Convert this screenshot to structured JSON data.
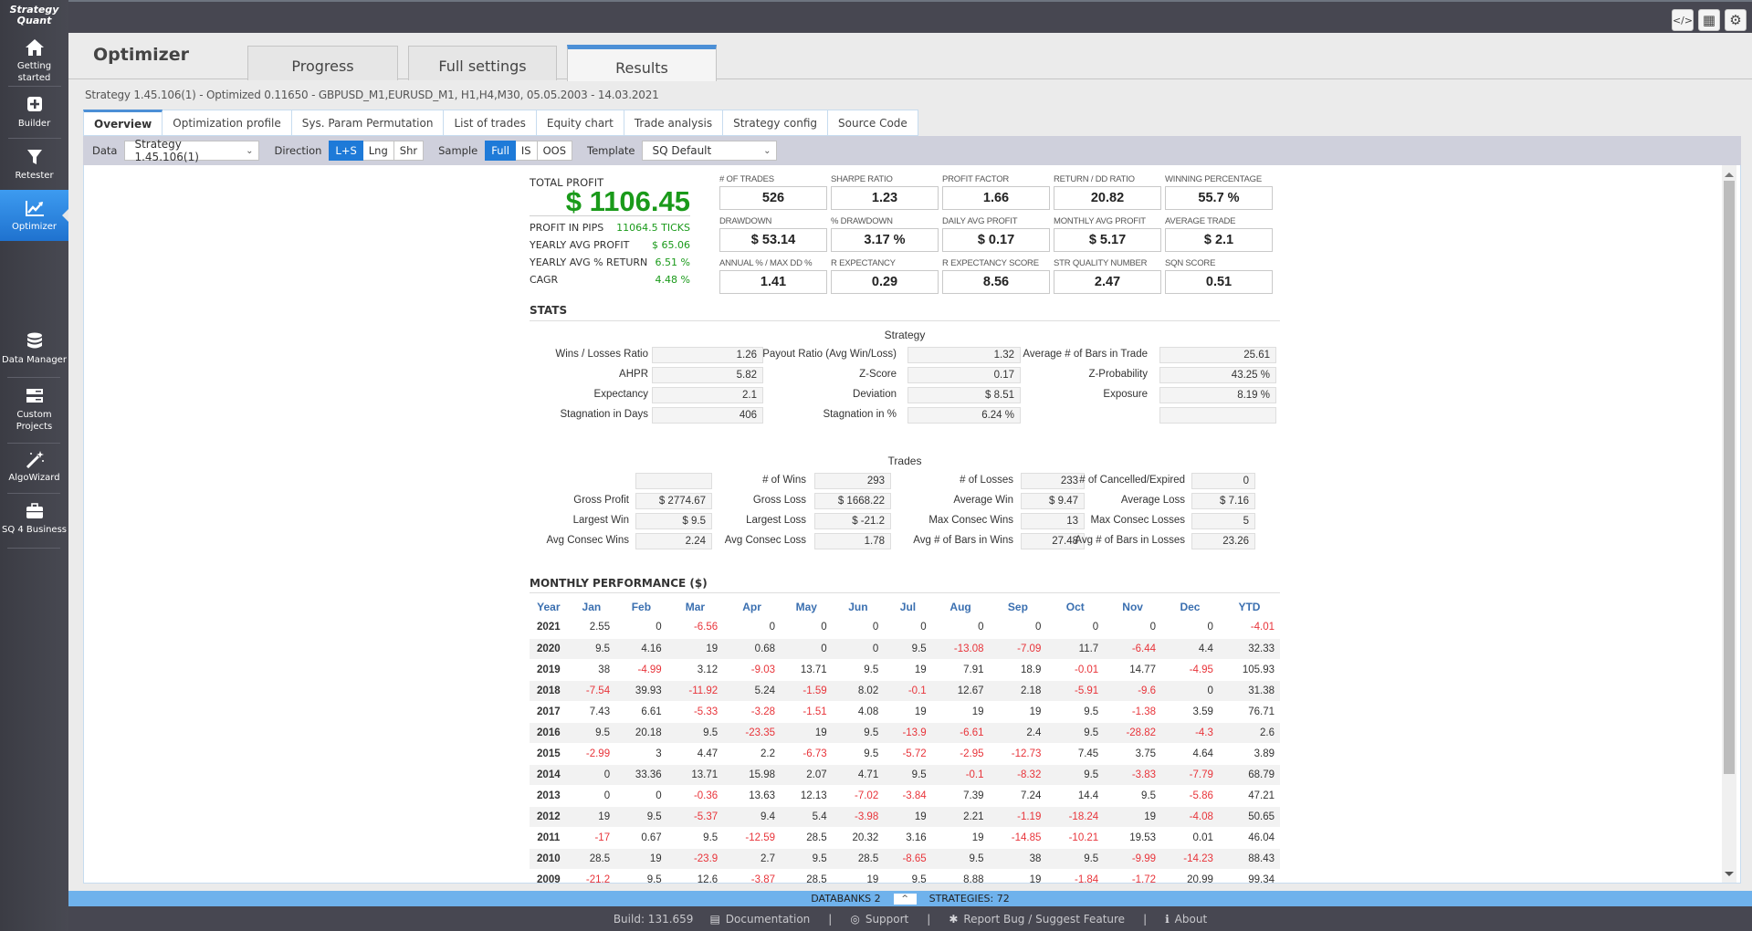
{
  "app": {
    "logo_line1": "Strategy",
    "logo_line2": "Quant"
  },
  "sidebar": {
    "items": [
      {
        "label": "Getting started",
        "icon": "home-icon"
      },
      {
        "label": "Builder",
        "icon": "plus-box-icon"
      },
      {
        "label": "Retester",
        "icon": "filter-icon"
      },
      {
        "label": "Optimizer",
        "icon": "chart-line-icon",
        "active": true
      },
      {
        "label": "Data Manager",
        "icon": "database-icon"
      },
      {
        "label": "Custom Projects",
        "icon": "server-list-icon"
      },
      {
        "label": "AlgoWizard",
        "icon": "magic-wand-icon"
      },
      {
        "label": "SQ 4 Business",
        "icon": "briefcase-icon"
      }
    ]
  },
  "topbar": {
    "buttons": [
      {
        "icon": "code-icon",
        "glyph": "</>"
      },
      {
        "icon": "layout-grid-icon",
        "glyph": "▦"
      },
      {
        "icon": "gear-icon",
        "glyph": "⚙"
      }
    ]
  },
  "header": {
    "title": "Optimizer",
    "tabs": [
      {
        "label": "Progress"
      },
      {
        "label": "Full settings"
      },
      {
        "label": "Results",
        "active": true
      }
    ],
    "subtitle": "Strategy 1.45.106(1) - Optimized 0.11650 - GBPUSD_M1,EURUSD_M1, H1,H4,M30, 05.05.2003 - 14.03.2021"
  },
  "subtabs": [
    "Overview",
    "Optimization profile",
    "Sys. Param Permutation",
    "List of trades",
    "Equity chart",
    "Trade analysis",
    "Strategy config",
    "Source Code"
  ],
  "filters": {
    "data_label": "Data",
    "data_value": "Strategy 1.45.106(1)",
    "direction_label": "Direction",
    "direction_options": [
      "L+S",
      "Lng",
      "Shr"
    ],
    "direction_selected": "L+S",
    "sample_label": "Sample",
    "sample_options": [
      "Full",
      "IS",
      "OOS"
    ],
    "sample_selected": "Full",
    "template_label": "Template",
    "template_value": "SQ Default"
  },
  "summary": {
    "total_profit_label": "TOTAL PROFIT",
    "total_profit": "$ 1106.45",
    "rows": [
      {
        "label": "PROFIT IN PIPS",
        "value": "11064.5 TICKS"
      },
      {
        "label": "YEARLY AVG PROFIT",
        "value": "$ 65.06"
      },
      {
        "label": "YEARLY AVG % RETURN",
        "value": "6.51 %"
      },
      {
        "label": "CAGR",
        "value": "4.48 %"
      }
    ],
    "metrics": [
      {
        "label": "# OF TRADES",
        "value": "526"
      },
      {
        "label": "SHARPE RATIO",
        "value": "1.23"
      },
      {
        "label": "PROFIT FACTOR",
        "value": "1.66"
      },
      {
        "label": "RETURN / DD RATIO",
        "value": "20.82"
      },
      {
        "label": "WINNING PERCENTAGE",
        "value": "55.7 %"
      },
      {
        "label": "DRAWDOWN",
        "value": "$ 53.14"
      },
      {
        "label": "% DRAWDOWN",
        "value": "3.17 %"
      },
      {
        "label": "DAILY AVG PROFIT",
        "value": "$ 0.17"
      },
      {
        "label": "MONTHLY AVG PROFIT",
        "value": "$ 5.17"
      },
      {
        "label": "AVERAGE TRADE",
        "value": "$ 2.1"
      },
      {
        "label": "ANNUAL % / MAX DD %",
        "value": "1.41"
      },
      {
        "label": "R EXPECTANCY",
        "value": "0.29"
      },
      {
        "label": "R EXPECTANCY SCORE",
        "value": "8.56"
      },
      {
        "label": "STR QUALITY NUMBER",
        "value": "2.47"
      },
      {
        "label": "SQN SCORE",
        "value": "0.51"
      }
    ]
  },
  "stats": {
    "title": "STATS",
    "strategy_title": "Strategy",
    "strategy_rows": [
      [
        {
          "label": "Wins / Losses Ratio",
          "value": "1.26"
        },
        {
          "label": "Payout Ratio (Avg Win/Loss)",
          "value": "1.32"
        },
        {
          "label": "Average # of Bars in Trade",
          "value": "25.61"
        }
      ],
      [
        {
          "label": "AHPR",
          "value": "5.82"
        },
        {
          "label": "Z-Score",
          "value": "0.17"
        },
        {
          "label": "Z-Probability",
          "value": "43.25 %"
        }
      ],
      [
        {
          "label": "Expectancy",
          "value": "2.1"
        },
        {
          "label": "Deviation",
          "value": "$ 8.51"
        },
        {
          "label": "Exposure",
          "value": "8.19 %"
        }
      ],
      [
        {
          "label": "Stagnation in Days",
          "value": "406"
        },
        {
          "label": "Stagnation in %",
          "value": "6.24 %"
        },
        {
          "label": "",
          "value": ""
        }
      ]
    ],
    "trades_title": "Trades",
    "trades_rows": [
      [
        {
          "label": "",
          "value": ""
        },
        {
          "label": "# of Wins",
          "value": "293"
        },
        {
          "label": "# of Losses",
          "value": "233"
        },
        {
          "label": "# of Cancelled/Expired",
          "value": "0"
        }
      ],
      [
        {
          "label": "Gross Profit",
          "value": "$ 2774.67"
        },
        {
          "label": "Gross Loss",
          "value": "$ 1668.22"
        },
        {
          "label": "Average Win",
          "value": "$ 9.47"
        },
        {
          "label": "Average Loss",
          "value": "$ 7.16"
        }
      ],
      [
        {
          "label": "Largest Win",
          "value": "$ 9.5"
        },
        {
          "label": "Largest Loss",
          "value": "$ -21.2"
        },
        {
          "label": "Max Consec Wins",
          "value": "13"
        },
        {
          "label": "Max Consec Losses",
          "value": "5"
        }
      ],
      [
        {
          "label": "Avg Consec Wins",
          "value": "2.24"
        },
        {
          "label": "Avg Consec Loss",
          "value": "1.78"
        },
        {
          "label": "Avg # of Bars in Wins",
          "value": "27.48"
        },
        {
          "label": "Avg # of Bars in Losses",
          "value": "23.26"
        }
      ]
    ]
  },
  "monthly": {
    "title": "MONTHLY PERFORMANCE ($)",
    "columns": [
      "Year",
      "Jan",
      "Feb",
      "Mar",
      "Apr",
      "May",
      "Jun",
      "Jul",
      "Aug",
      "Sep",
      "Oct",
      "Nov",
      "Dec",
      "YTD"
    ],
    "rows": [
      [
        "2021",
        "2.55",
        "0",
        "-6.56",
        "0",
        "0",
        "0",
        "0",
        "0",
        "0",
        "0",
        "0",
        "0",
        "-4.01"
      ],
      [
        "2020",
        "9.5",
        "4.16",
        "19",
        "0.68",
        "0",
        "0",
        "9.5",
        "-13.08",
        "-7.09",
        "11.7",
        "-6.44",
        "4.4",
        "32.33"
      ],
      [
        "2019",
        "38",
        "-4.99",
        "3.12",
        "-9.03",
        "13.71",
        "9.5",
        "19",
        "7.91",
        "18.9",
        "-0.01",
        "14.77",
        "-4.95",
        "105.93"
      ],
      [
        "2018",
        "-7.54",
        "39.93",
        "-11.92",
        "5.24",
        "-1.59",
        "8.02",
        "-0.1",
        "12.67",
        "2.18",
        "-5.91",
        "-9.6",
        "0",
        "31.38"
      ],
      [
        "2017",
        "7.43",
        "6.61",
        "-5.33",
        "-3.28",
        "-1.51",
        "4.08",
        "19",
        "19",
        "19",
        "9.5",
        "-1.38",
        "3.59",
        "76.71"
      ],
      [
        "2016",
        "9.5",
        "20.18",
        "9.5",
        "-23.35",
        "19",
        "9.5",
        "-13.9",
        "-6.61",
        "2.4",
        "9.5",
        "-28.82",
        "-4.3",
        "2.6"
      ],
      [
        "2015",
        "-2.99",
        "3",
        "4.47",
        "2.2",
        "-6.73",
        "9.5",
        "-5.72",
        "-2.95",
        "-12.73",
        "7.45",
        "3.75",
        "4.64",
        "3.89"
      ],
      [
        "2014",
        "0",
        "33.36",
        "13.71",
        "15.98",
        "2.07",
        "4.71",
        "9.5",
        "-0.1",
        "-8.32",
        "9.5",
        "-3.83",
        "-7.79",
        "68.79"
      ],
      [
        "2013",
        "0",
        "0",
        "-0.36",
        "13.63",
        "12.13",
        "-7.02",
        "-3.84",
        "7.39",
        "7.24",
        "14.4",
        "9.5",
        "-5.86",
        "47.21"
      ],
      [
        "2012",
        "19",
        "9.5",
        "-5.37",
        "9.4",
        "5.4",
        "-3.98",
        "19",
        "2.21",
        "-1.19",
        "-18.24",
        "19",
        "-4.08",
        "50.65"
      ],
      [
        "2011",
        "-17",
        "0.67",
        "9.5",
        "-12.59",
        "28.5",
        "20.32",
        "3.16",
        "19",
        "-14.85",
        "-10.21",
        "19.53",
        "0.01",
        "46.04"
      ],
      [
        "2010",
        "28.5",
        "19",
        "-23.9",
        "2.7",
        "9.5",
        "28.5",
        "-8.65",
        "9.5",
        "38",
        "9.5",
        "-9.99",
        "-14.23",
        "88.43"
      ],
      [
        "2009",
        "-21.2",
        "9.5",
        "12.6",
        "-3.87",
        "28.5",
        "19",
        "9.5",
        "8.88",
        "19",
        "-1.84",
        "-1.72",
        "20.99",
        "99.34"
      ]
    ]
  },
  "statusbar": {
    "databanks": "DATABANKS 2",
    "toggle_glyph": "^",
    "strategies": "STRATEGIES: 72"
  },
  "footer": {
    "build": "Build: 131.659",
    "links": [
      {
        "label": "Documentation",
        "icon": "book-icon",
        "glyph": "▤"
      },
      {
        "label": "Support",
        "icon": "lifebuoy-icon",
        "glyph": "◎"
      },
      {
        "label": "Report Bug / Suggest Feature",
        "icon": "bug-icon",
        "glyph": "✱"
      },
      {
        "label": "About",
        "icon": "info-icon",
        "glyph": "ℹ"
      }
    ],
    "separator": "|"
  },
  "colors": {
    "accent": "#1e7ad8",
    "sidebar_active": "#2f86e0",
    "positive": "#1a9a1a",
    "negative": "#e8343a",
    "header_link": "#3a6fb0"
  }
}
